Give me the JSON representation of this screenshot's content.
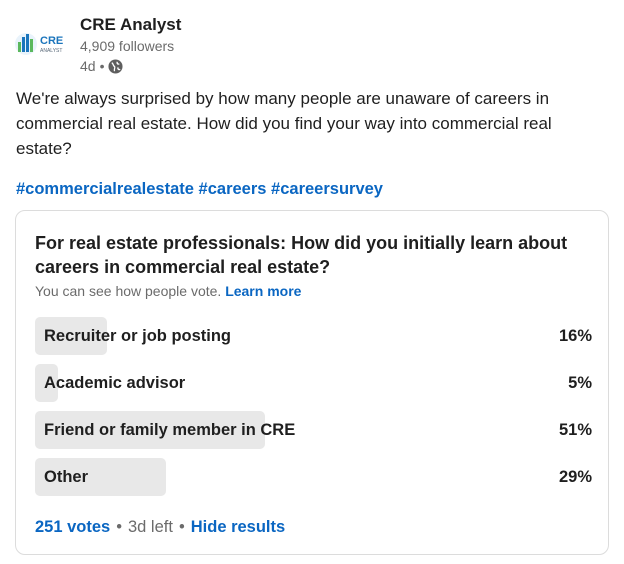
{
  "author": {
    "logo_text": "CRE",
    "logo_subtext": "ANALYST",
    "name": "CRE Analyst",
    "followers": "4,909 followers",
    "age": "4d",
    "separator": "•",
    "visibility_icon": "globe-icon"
  },
  "post": {
    "text": "We're always surprised by how many people are unaware of careers in commercial real estate. How did you find your way into commercial real estate?",
    "hashtags": [
      "#commercialrealestate",
      "#careers",
      "#careersurvey"
    ]
  },
  "poll": {
    "question": "For real estate professionals: How did you initially learn about careers in commercial real estate?",
    "subtitle": "You can see how people vote.",
    "learn_more": "Learn more",
    "options": [
      {
        "label": "Recruiter or job posting",
        "percent_text": "16%",
        "percent": 16
      },
      {
        "label": "Academic advisor",
        "percent_text": "5%",
        "percent": 5
      },
      {
        "label": "Friend or family member in CRE",
        "percent_text": "51%",
        "percent": 51
      },
      {
        "label": "Other",
        "percent_text": "29%",
        "percent": 29
      }
    ],
    "votes": "251 votes",
    "time_left": "3d left",
    "hide_results": "Hide results",
    "separator": "•"
  },
  "colors": {
    "link_blue": "#0a66c2",
    "bar_fill": "#e8e8e8",
    "muted_text": "#6b6b6b",
    "logo_blue": "#1b75bc",
    "logo_green": "#5bb85d"
  }
}
